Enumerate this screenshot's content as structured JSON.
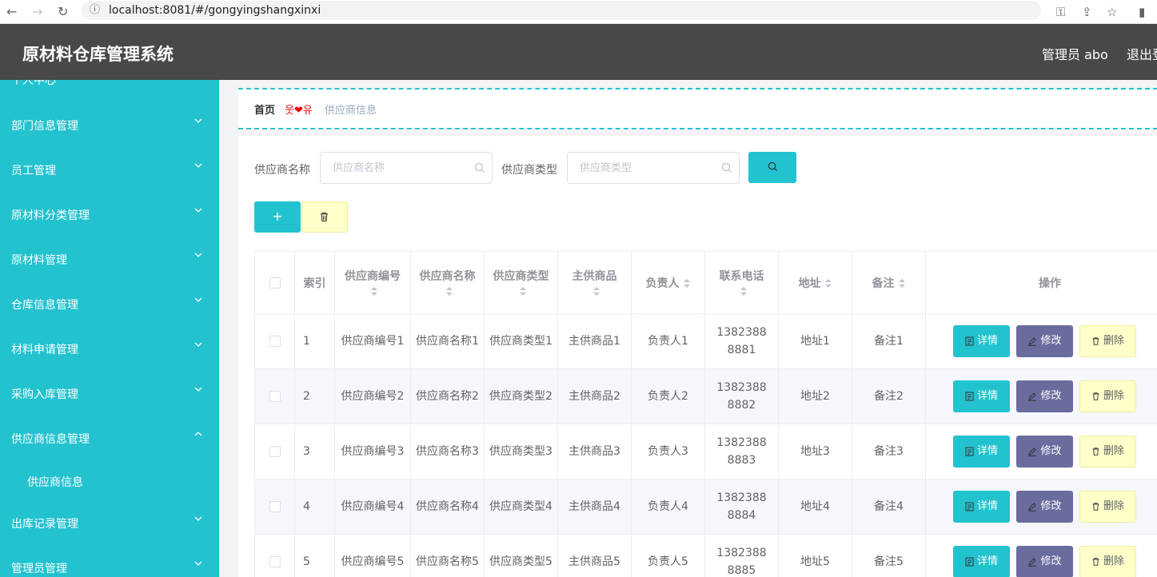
{
  "browser": {
    "url": "localhost:8081/#/gongyingshangxinxi"
  },
  "header": {
    "title": "原材料仓库管理系统",
    "user": "管理员 abo",
    "logout": "退出登录"
  },
  "sidebar": {
    "partial_top": "个人中心",
    "items": [
      {
        "label": "部门信息管理"
      },
      {
        "label": "员工管理"
      },
      {
        "label": "原材料分类管理"
      },
      {
        "label": "原材料管理"
      },
      {
        "label": "仓库信息管理"
      },
      {
        "label": "材料申请管理"
      },
      {
        "label": "采购入库管理"
      },
      {
        "label": "供应商信息管理"
      },
      {
        "label": "出库记录管理"
      },
      {
        "label": "管理员管理"
      }
    ],
    "sub_item": "供应商信息"
  },
  "breadcrumb": {
    "home": "首页",
    "separator": "웃❤유",
    "current": "供应商信息"
  },
  "search": {
    "name_label": "供应商名称",
    "name_placeholder": "供应商名称",
    "type_label": "供应商类型",
    "type_placeholder": "供应商类型"
  },
  "table": {
    "headers": {
      "index": "索引",
      "code": "供应商编号",
      "name": "供应商名称",
      "type": "供应商类型",
      "goods": "主供商品",
      "person": "负责人",
      "phone": "联系电话",
      "addr": "地址",
      "note": "备注",
      "ops": "操作"
    },
    "rows": [
      {
        "index": "1",
        "code": "供应商编号1",
        "name": "供应商名称1",
        "type": "供应商类型1",
        "goods": "主供商品1",
        "person": "负责人1",
        "phone": "13823888881",
        "addr": "地址1",
        "note": "备注1"
      },
      {
        "index": "2",
        "code": "供应商编号2",
        "name": "供应商名称2",
        "type": "供应商类型2",
        "goods": "主供商品2",
        "person": "负责人2",
        "phone": "13823888882",
        "addr": "地址2",
        "note": "备注2"
      },
      {
        "index": "3",
        "code": "供应商编号3",
        "name": "供应商名称3",
        "type": "供应商类型3",
        "goods": "主供商品3",
        "person": "负责人3",
        "phone": "13823888883",
        "addr": "地址3",
        "note": "备注3"
      },
      {
        "index": "4",
        "code": "供应商编号4",
        "name": "供应商名称4",
        "type": "供应商类型4",
        "goods": "主供商品4",
        "person": "负责人4",
        "phone": "13823888884",
        "addr": "地址4",
        "note": "备注4"
      },
      {
        "index": "5",
        "code": "供应商编号5",
        "name": "供应商名称5",
        "type": "供应商类型5",
        "goods": "主供商品5",
        "person": "负责人5",
        "phone": "13823888885",
        "addr": "地址5",
        "note": "备注5"
      }
    ],
    "actions": {
      "detail": "详情",
      "edit": "修改",
      "delete": "删除"
    }
  },
  "colors": {
    "accent": "#23c2cf",
    "header": "#484848",
    "edit": "#6b6c9e",
    "delete": "#ffffc9"
  }
}
